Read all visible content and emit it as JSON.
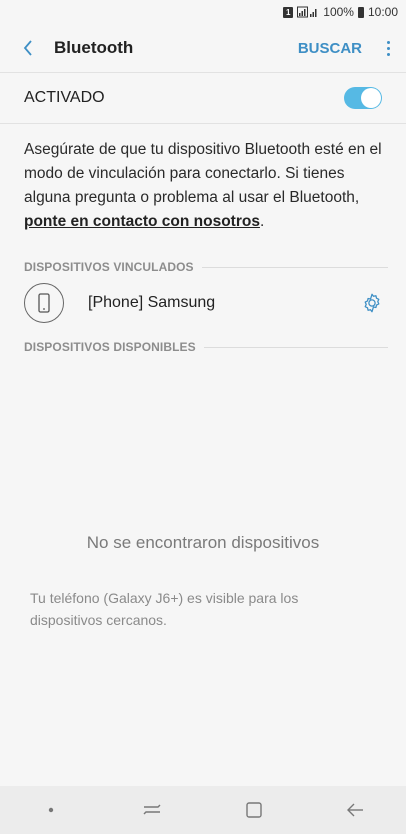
{
  "status_bar": {
    "battery_text": "100%",
    "time": "10:00",
    "sim_label": "1"
  },
  "header": {
    "title": "Bluetooth",
    "search_label": "BUSCAR"
  },
  "toggle": {
    "label": "ACTIVADO",
    "state": "on",
    "color": "#56b9e4"
  },
  "info": {
    "text": "Asegúrate de que tu dispositivo Bluetooth esté en el modo de vinculación para conectarlo. Si tienes alguna pregunta o problema al usar el Bluetooth, ",
    "link": "ponte en contacto con nosotros",
    "end": "."
  },
  "paired": {
    "header": "DISPOSITIVOS VINCULADOS",
    "devices": [
      {
        "name": "[Phone] Samsung",
        "icon": "phone-icon"
      }
    ]
  },
  "available": {
    "header": "DISPOSITIVOS DISPONIBLES",
    "empty_text": "No se encontraron dispositivos",
    "visibility_text": "Tu teléfono (Galaxy J6+) es visible para los dispositivos cercanos."
  },
  "nav": {
    "items": [
      "dot-icon",
      "recents-icon",
      "home-icon",
      "back-icon"
    ]
  },
  "colors": {
    "accent": "#3e8fc5",
    "background": "#f6f6f6"
  }
}
